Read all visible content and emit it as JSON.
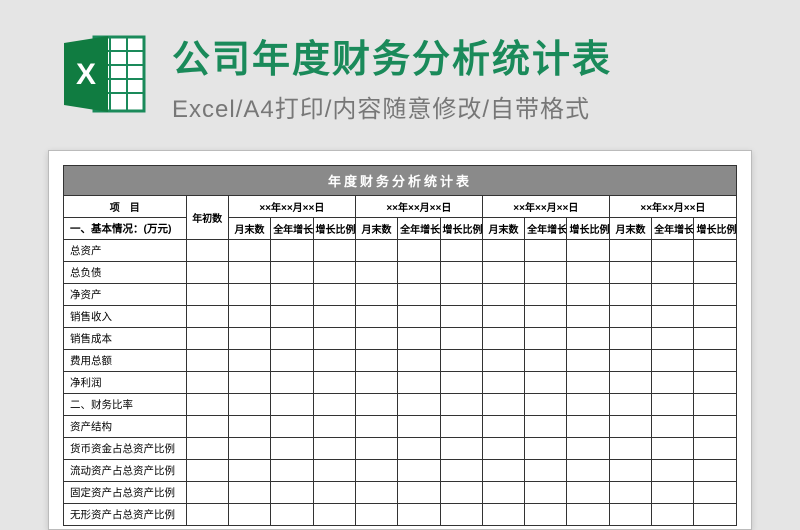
{
  "header": {
    "title": "公司年度财务分析统计表",
    "subtitle": "Excel/A4打印/内容随意修改/自带格式",
    "icon_name": "excel-icon"
  },
  "table": {
    "title": "年度财务分析统计表",
    "header": {
      "project": "项　目",
      "year_start": "年初数",
      "period_label": "××年××月××日",
      "sub": {
        "month_end": "月末数",
        "year_inc": "全年增长额",
        "growth_ratio": "增长比例"
      }
    },
    "rows": [
      "一、基本情况：(万元)",
      "总资产",
      "总负债",
      "净资产",
      "销售收入",
      "销售成本",
      "费用总额",
      "净利润",
      "二、财务比率",
      "资产结构",
      "货币资金占总资产比例",
      "流动资产占总资产比例",
      "固定资产占总资产比例",
      "无形资产占总资产比例"
    ]
  }
}
